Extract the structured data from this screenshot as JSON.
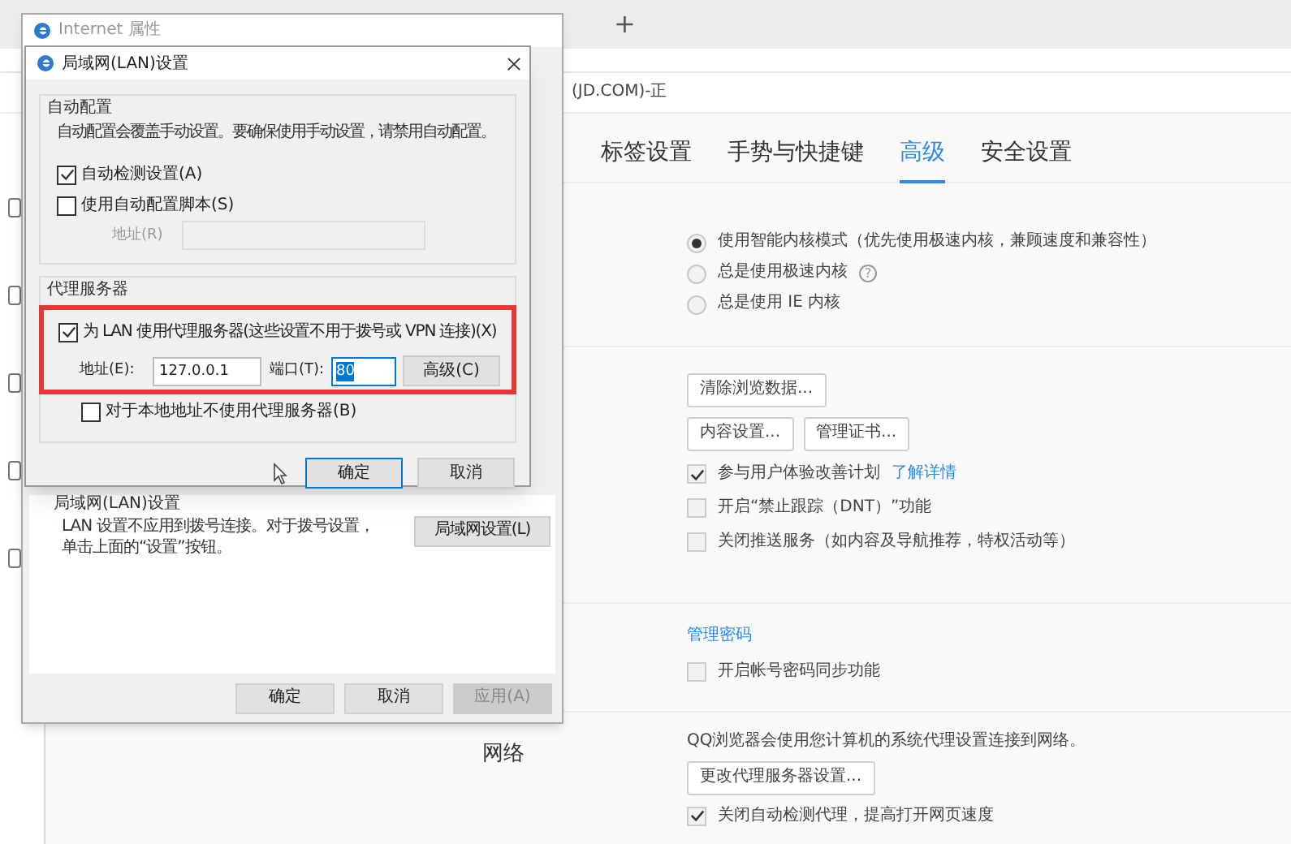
{
  "browser": {
    "new_tab_glyph": "+",
    "page_title": "(JD.COM)-正",
    "tabs": [
      {
        "label": "标签设置",
        "selected": false
      },
      {
        "label": "手势与快捷键",
        "selected": false
      },
      {
        "label": "高级",
        "selected": true
      },
      {
        "label": "安全设置",
        "selected": false
      }
    ],
    "kernel_options": [
      {
        "label": "使用智能内核模式（优先使用极速内核，兼顾速度和兼容性）",
        "selected": true
      },
      {
        "label": "总是使用极速内核",
        "selected": false,
        "help": "?"
      },
      {
        "label": "总是使用 IE 内核",
        "selected": false
      }
    ],
    "privacy": {
      "button_rows": [
        [
          "清除浏览数据..."
        ],
        [
          "内容设置...",
          "管理证书..."
        ]
      ],
      "checkboxes": [
        {
          "label": "参与用户体验改善计划",
          "checked": true,
          "link": "了解详情"
        },
        {
          "label": "开启“禁止跟踪（DNT）”功能",
          "checked": false
        },
        {
          "label": "关闭推送服务（如内容及导航推荐，特权活动等）",
          "checked": false
        }
      ]
    },
    "password": {
      "link": "管理密码",
      "checkboxes": [
        {
          "label": "开启帐号密码同步功能",
          "checked": false
        }
      ]
    },
    "network": {
      "label": "网络",
      "description": "QQ浏览器会使用您计算机的系统代理设置连接到网络。",
      "button": "更改代理服务器设置...",
      "checkboxes": [
        {
          "label": "关闭自动检测代理，提高打开网页速度",
          "checked": true
        }
      ]
    }
  },
  "internet_options": {
    "title": "Internet 属性",
    "lan_group": {
      "title": "局域网(LAN)设置",
      "text": "LAN 设置不应用到拨号连接。对于拨号设置，单击上面的“设置”按钮。",
      "button": "局域网设置(L)"
    },
    "buttons": [
      {
        "label": "确定",
        "disabled": false
      },
      {
        "label": "取消",
        "disabled": false
      },
      {
        "label": "应用(A)",
        "disabled": true
      }
    ]
  },
  "lan_dialog": {
    "title": "局域网(LAN)设置",
    "auto_config": {
      "title": "自动配置",
      "note": "自动配置会覆盖手动设置。要确保使用手动设置，请禁用自动配置。",
      "checkboxes": [
        {
          "label": "自动检测设置(A)",
          "checked": true
        },
        {
          "label": "使用自动配置脚本(S)",
          "checked": false
        }
      ],
      "script_address": {
        "label": "地址(R)",
        "disabled": true
      }
    },
    "proxy": {
      "title": "代理服务器",
      "use_proxy": {
        "label": "为 LAN 使用代理服务器(这些设置不用于拨号或 VPN 连接)(X)",
        "checked": true
      },
      "address": {
        "label": "地址(E):",
        "value": "127.0.0.1"
      },
      "port": {
        "label": "端口(T):",
        "value": "80",
        "highlighted": true
      },
      "advanced_button": "高级(C)",
      "bypass_local": {
        "label": "对于本地地址不使用代理服务器(B)",
        "checked": false
      }
    },
    "buttons": [
      {
        "label": "确定",
        "default": true
      },
      {
        "label": "取消",
        "default": false
      }
    ]
  }
}
